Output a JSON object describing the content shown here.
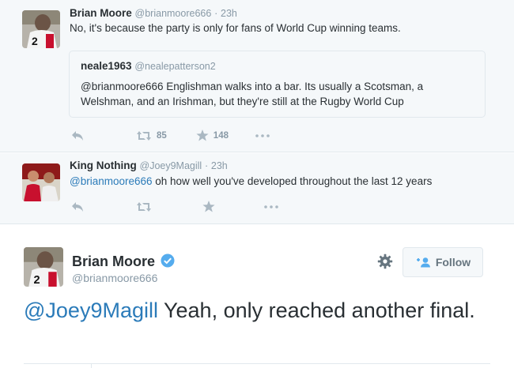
{
  "tweet1": {
    "name": "Brian Moore",
    "handle": "@brianmoore666",
    "separator": "·",
    "time": "23h",
    "text": "No, it's because the party is only for fans of World Cup winning teams.",
    "quote": {
      "name": "neale1963",
      "handle": "@nealepatterson2",
      "mention": "@brianmoore666",
      "text_line1": " Englishman walks into a bar. Its usually a Scotsman, a",
      "text_line2": "Welshman, and an Irishman, but they're still at the Rugby World Cup"
    },
    "retweets": "85",
    "favorites": "148"
  },
  "tweet2": {
    "name": "King Nothing",
    "handle": "@Joey9Magill",
    "separator": "·",
    "time": "23h",
    "mention": "@brianmoore666",
    "text": " oh how well you've developed throughout the last 12 years"
  },
  "main_tweet": {
    "name": "Brian Moore",
    "handle": "@brianmoore666",
    "follow_label": "Follow",
    "mention": "@Joey9Magill",
    "text": " Yeah, only reached another final."
  },
  "icons": [
    "reply-icon",
    "retweet-icon",
    "favorite-icon",
    "more-icon",
    "verified-icon",
    "gear-icon",
    "follow-person-icon"
  ],
  "colors": {
    "link": "#2b7bb9",
    "verified": "#55acee",
    "muted": "#8899a6",
    "icon": "#aab8c2"
  }
}
